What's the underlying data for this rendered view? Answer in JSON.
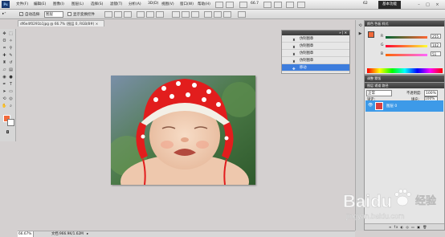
{
  "menubar": {
    "app_logo": "Ps",
    "items": [
      "文件(F)",
      "编辑(E)",
      "图像(I)",
      "图层(L)",
      "选择(S)",
      "滤镜(T)",
      "分析(A)",
      "3D(D)",
      "视图(V)",
      "窗口(W)",
      "帮助(H)"
    ],
    "zoom": "66.7",
    "workspace_number": "62",
    "essentials": "基本功能",
    "window_controls": [
      "–",
      "□",
      "×"
    ]
  },
  "options": {
    "auto_select_label": "自动选择:",
    "auto_select_value": "图层",
    "show_transform_label": "显示变换控件",
    "checkmark": "✓"
  },
  "document": {
    "tab_title": "df6e4f0291b1jpg @ 66.7% (图层 0, RGB/8#) ×",
    "status_zoom": "66.67%",
    "status_doc": "文档:966.9K/1.62M"
  },
  "history": {
    "header": "» | ✕",
    "items": [
      {
        "label": "仿制图章",
        "active": false
      },
      {
        "label": "仿制图章",
        "active": false
      },
      {
        "label": "仿制图章",
        "active": false
      },
      {
        "label": "仿制图章",
        "active": false
      },
      {
        "label": "移动",
        "active": true
      }
    ]
  },
  "color_panel": {
    "header": "颜色  色板  样式",
    "r_label": "R",
    "r_value": "255",
    "g_label": "G",
    "g_value": "102",
    "b_label": "B",
    "b_value": "51"
  },
  "adjust_panel": {
    "header": "调整  蒙版"
  },
  "layers_panel": {
    "header": "图层  通道  路径",
    "blend_mode": "正常",
    "opacity_label": "不透明度:",
    "opacity_value": "100%",
    "lock_label": "锁定:",
    "fill_label": "填充:",
    "fill_value": "100%",
    "layer_name": "图层 0",
    "footer_icons": "∞ fx ◐ ◎ ▭ ▣ 🗑"
  },
  "watermark": {
    "brand": "Baidu",
    "sub": "jingyan.baidu.com",
    "cn": "经验"
  },
  "colors": {
    "foreground": "#f26a3b",
    "background": "#ffffff",
    "selection": "#3d7ddd",
    "layer_selected": "#3d9ae8"
  }
}
